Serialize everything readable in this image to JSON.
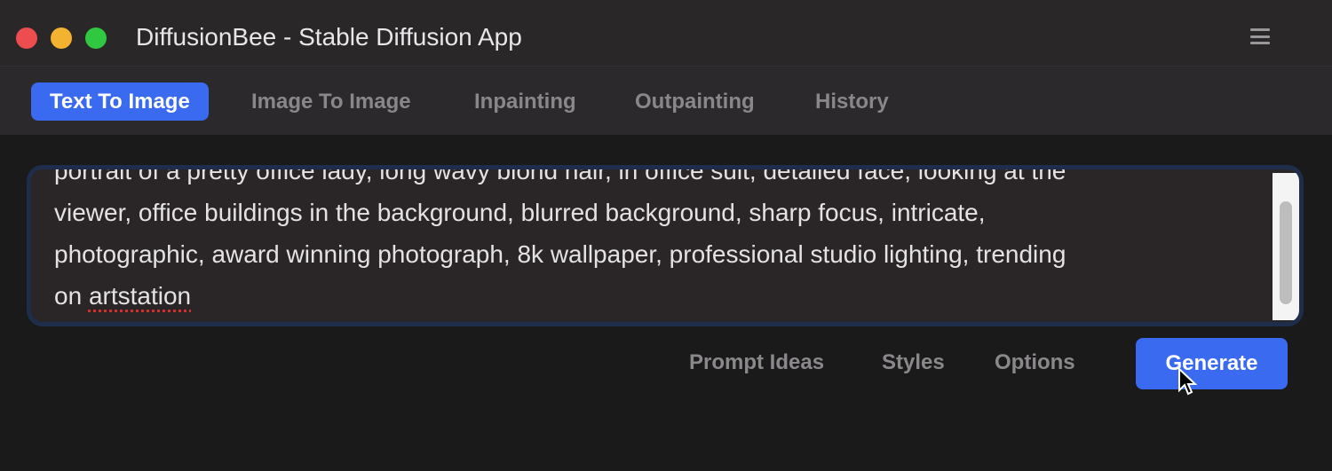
{
  "window": {
    "title": "DiffusionBee - Stable Diffusion App",
    "traffic_lights": {
      "close": "#ee4d4f",
      "minimize": "#f4b231",
      "maximize": "#30c840"
    },
    "menu_icon": "hamburger-menu-icon"
  },
  "tabs": [
    {
      "label": "Text To Image",
      "active": true
    },
    {
      "label": "Image To Image",
      "active": false
    },
    {
      "label": "Inpainting",
      "active": false
    },
    {
      "label": "Outpainting",
      "active": false
    },
    {
      "label": "History",
      "active": false
    }
  ],
  "prompt": {
    "lines": [
      "portrait of a pretty office lady, long wavy blond hair, in office suit, detailed face, looking at the",
      "viewer, office buildings in the background, blurred background, sharp focus, intricate,",
      "photographic, award winning photograph, 8k wallpaper, professional studio lighting, trending",
      "on ",
      "artstation"
    ]
  },
  "actions": {
    "prompt_ideas": "Prompt Ideas",
    "styles": "Styles",
    "options": "Options",
    "generate": "Generate"
  },
  "colors": {
    "accent": "#3a6af0",
    "background": "#1b1a1b"
  }
}
